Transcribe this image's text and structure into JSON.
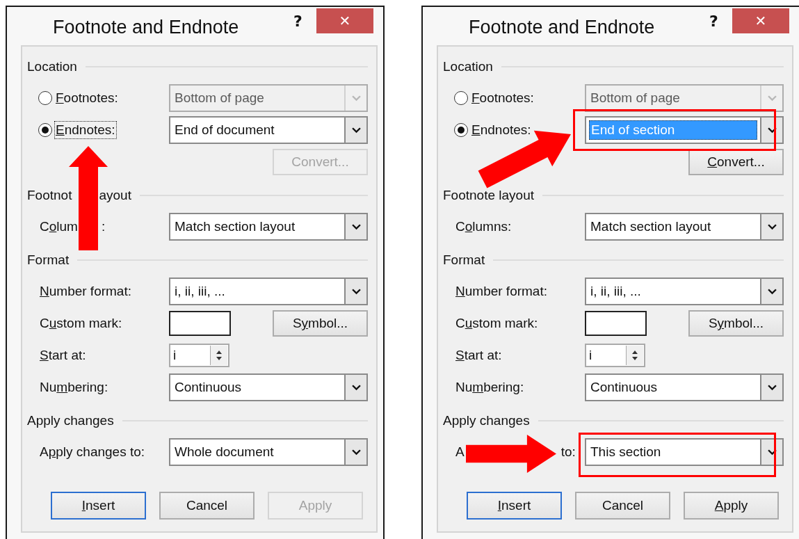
{
  "dialogs": [
    {
      "title": "Footnote and Endnote",
      "help": "?",
      "close": "✕",
      "sections": [
        {
          "heading": "Location",
          "rows": [
            {
              "kind": "radio",
              "label": {
                "key": "F",
                "post": "ootnotes:"
              },
              "selected": false,
              "focused": false,
              "select": {
                "value": "Bottom of page",
                "disabled": true,
                "highlighted": false
              }
            },
            {
              "kind": "radio",
              "label": {
                "key": "E",
                "post": "ndnotes:"
              },
              "selected": true,
              "focused": true,
              "select": {
                "value": "End of document",
                "disabled": false,
                "highlighted": false
              }
            },
            {
              "kind": "button",
              "button": {
                "label": {
                  "pre": "Convert..."
                },
                "disabled": true
              }
            }
          ]
        },
        {
          "heading": "Footnot",
          "heading_after_arrow": "ayout",
          "rows": [
            {
              "kind": "select",
              "label": {
                "pre": "C",
                "key": "o",
                "post": "lum"
              },
              "label_after_arrow": {
                "pre": ":"
              },
              "select": {
                "value": "Match section layout",
                "disabled": false,
                "highlighted": false
              }
            }
          ]
        },
        {
          "heading": "Format",
          "rows": [
            {
              "kind": "select",
              "label": {
                "key": "N",
                "post": "umber format:"
              },
              "select": {
                "value": "i, ii, iii, ...",
                "disabled": false,
                "highlighted": false
              }
            },
            {
              "kind": "input-button",
              "label": {
                "pre": "C",
                "key": "u",
                "post": "stom mark:"
              },
              "button": {
                "label": {
                  "pre": "S",
                  "key": "y",
                  "post": "mbol..."
                },
                "disabled": false
              }
            },
            {
              "kind": "spinner",
              "label": {
                "key": "S",
                "post": "tart at:"
              },
              "spinner": {
                "value": "i"
              }
            },
            {
              "kind": "select",
              "label": {
                "pre": "Nu",
                "key": "m",
                "post": "bering:"
              },
              "select": {
                "value": "Continuous",
                "disabled": false,
                "highlighted": false
              }
            }
          ]
        },
        {
          "heading": "Apply changes",
          "rows": [
            {
              "kind": "select",
              "label": {
                "pre": "A",
                "key": "p",
                "post": "ply changes to:"
              },
              "select": {
                "value": "Whole document",
                "disabled": false,
                "highlighted": false
              }
            }
          ]
        }
      ],
      "buttons": [
        {
          "label": {
            "key": "I",
            "post": "nsert"
          },
          "default": true,
          "disabled": false
        },
        {
          "label": {
            "pre": "Cancel"
          },
          "default": false,
          "disabled": false
        },
        {
          "label": {
            "pre": "Apply"
          },
          "default": false,
          "disabled": true
        }
      ],
      "annotations": [
        {
          "kind": "arrow-up"
        }
      ]
    },
    {
      "title": "Footnote and Endnote",
      "help": "?",
      "close": "✕",
      "sections": [
        {
          "heading": "Location",
          "rows": [
            {
              "kind": "radio",
              "label": {
                "key": "F",
                "post": "ootnotes:"
              },
              "selected": false,
              "focused": false,
              "select": {
                "value": "Bottom of page",
                "disabled": true,
                "highlighted": false
              }
            },
            {
              "kind": "radio",
              "label": {
                "key": "E",
                "post": "ndnotes:"
              },
              "selected": true,
              "focused": false,
              "select": {
                "value": "End of section",
                "disabled": false,
                "highlighted": true
              }
            },
            {
              "kind": "button",
              "button": {
                "label": {
                  "key": "C",
                  "post": "onvert..."
                },
                "disabled": false
              }
            }
          ]
        },
        {
          "heading": "Footnote layout",
          "rows": [
            {
              "kind": "select",
              "label": {
                "pre": "C",
                "key": "o",
                "post": "lumns:"
              },
              "select": {
                "value": "Match section layout",
                "disabled": false,
                "highlighted": false
              }
            }
          ]
        },
        {
          "heading": "Format",
          "rows": [
            {
              "kind": "select",
              "label": {
                "key": "N",
                "post": "umber format:"
              },
              "select": {
                "value": "i, ii, iii, ...",
                "disabled": false,
                "highlighted": false
              }
            },
            {
              "kind": "input-button",
              "label": {
                "pre": "C",
                "key": "u",
                "post": "stom mark:"
              },
              "button": {
                "label": {
                  "pre": "S",
                  "key": "y",
                  "post": "mbol..."
                },
                "disabled": false
              }
            },
            {
              "kind": "spinner",
              "label": {
                "key": "S",
                "post": "tart at:"
              },
              "spinner": {
                "value": "i"
              }
            },
            {
              "kind": "select",
              "label": {
                "pre": "Nu",
                "key": "m",
                "post": "bering:"
              },
              "select": {
                "value": "Continuous",
                "disabled": false,
                "highlighted": false
              }
            }
          ]
        },
        {
          "heading": "Apply changes",
          "rows": [
            {
              "kind": "select",
              "label": {
                "pre": "A"
              },
              "label_after_arrow": {
                "pre": "to:"
              },
              "select": {
                "value": "This section",
                "disabled": false,
                "highlighted": false
              }
            }
          ]
        }
      ],
      "buttons": [
        {
          "label": {
            "key": "I",
            "post": "nsert"
          },
          "default": true,
          "disabled": false
        },
        {
          "label": {
            "pre": "Cancel"
          },
          "default": false,
          "disabled": false
        },
        {
          "label": {
            "key": "A",
            "post": "pply"
          },
          "default": false,
          "disabled": false
        }
      ],
      "annotations": [
        {
          "kind": "frame-endnotes"
        },
        {
          "kind": "arrow-diagonal"
        },
        {
          "kind": "frame-apply"
        },
        {
          "kind": "arrow-right"
        }
      ]
    }
  ]
}
